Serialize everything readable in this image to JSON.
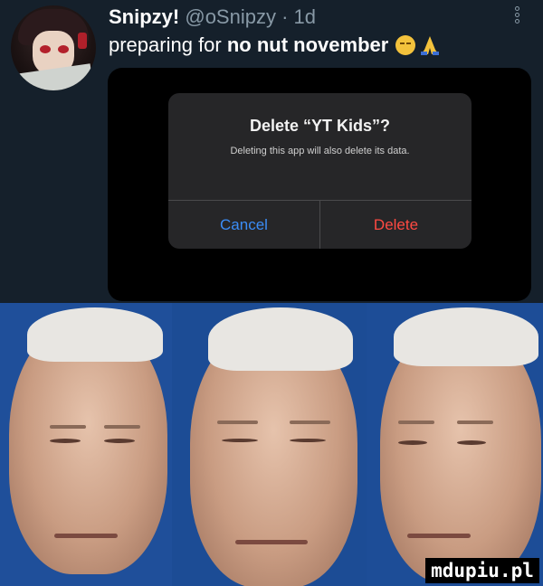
{
  "tweet": {
    "display_name": "Snipzy!",
    "handle_time": "@oSnipzy · 1d",
    "text_plain": "preparing for ",
    "text_bold": "no nut november"
  },
  "dialog": {
    "title": "Delete “YT Kids”?",
    "message": "Deleting this app will also delete its data.",
    "cancel_label": "Cancel",
    "delete_label": "Delete"
  },
  "watermark": "mdupiu.pl",
  "colors": {
    "background": "#15202b",
    "dialog_bg": "#262628",
    "cancel_blue": "#3b8df7",
    "delete_red": "#ff4a42",
    "panel_blue": "#1f4f9a"
  },
  "icons": {
    "emoji": "relieved-face-icon",
    "emoji2": "folded-hands-icon",
    "menu": "more-options-icon"
  }
}
